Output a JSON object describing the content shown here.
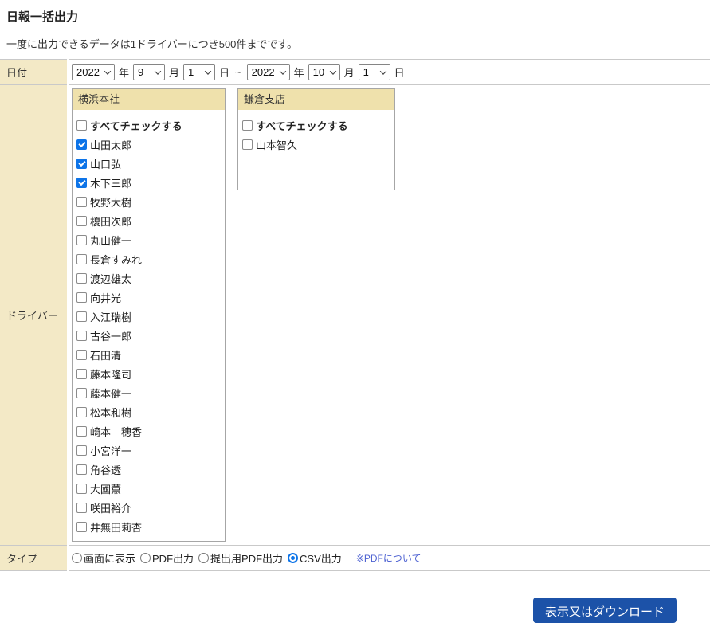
{
  "header": {
    "title": "日報一括出力",
    "note": "一度に出力できるデータは1ドライバーにつき500件までです。"
  },
  "date_row": {
    "label": "日付",
    "start": {
      "year": "2022",
      "month": "9",
      "day": "1"
    },
    "end": {
      "year": "2022",
      "month": "10",
      "day": "1"
    },
    "units": {
      "year": "年",
      "month": "月",
      "day": "日",
      "separator": "~"
    }
  },
  "driver_row": {
    "label": "ドライバー",
    "groups": [
      {
        "name": "横浜本社",
        "check_all_label": "すべてチェックする",
        "check_all_checked": false,
        "members": [
          {
            "name": "山田太郎",
            "checked": true
          },
          {
            "name": "山口弘",
            "checked": true
          },
          {
            "name": "木下三郎",
            "checked": true
          },
          {
            "name": "牧野大樹",
            "checked": false
          },
          {
            "name": "榎田次郎",
            "checked": false
          },
          {
            "name": "丸山健一",
            "checked": false
          },
          {
            "name": "長倉すみれ",
            "checked": false
          },
          {
            "name": "渡辺雄太",
            "checked": false
          },
          {
            "name": "向井光",
            "checked": false
          },
          {
            "name": "入江瑞樹",
            "checked": false
          },
          {
            "name": "古谷一郎",
            "checked": false
          },
          {
            "name": "石田清",
            "checked": false
          },
          {
            "name": "藤本隆司",
            "checked": false
          },
          {
            "name": "藤本健一",
            "checked": false
          },
          {
            "name": "松本和樹",
            "checked": false
          },
          {
            "name": "崎本　穂香",
            "checked": false
          },
          {
            "name": "小宮洋一",
            "checked": false
          },
          {
            "name": "角谷透",
            "checked": false
          },
          {
            "name": "大國薫",
            "checked": false
          },
          {
            "name": "咲田裕介",
            "checked": false
          },
          {
            "name": "井無田莉杏",
            "checked": false
          }
        ]
      },
      {
        "name": "鎌倉支店",
        "check_all_label": "すべてチェックする",
        "check_all_checked": false,
        "members": [
          {
            "name": "山本智久",
            "checked": false
          }
        ]
      }
    ]
  },
  "type_row": {
    "label": "タイプ",
    "options": [
      {
        "label": "画面に表示",
        "selected": false
      },
      {
        "label": "PDF出力",
        "selected": false
      },
      {
        "label": "提出用PDF出力",
        "selected": false
      },
      {
        "label": "CSV出力",
        "selected": true
      }
    ],
    "pdf_note": "※PDFについて"
  },
  "footer": {
    "submit_label": "表示又はダウンロード"
  },
  "colors": {
    "label_bg": "#f3e9c6",
    "group_header_bg": "#efe1ac",
    "checked_accent": "#0d74e8",
    "button_bg": "#1c52a8",
    "link": "#4f63d2",
    "row_border": "#c9c9c9"
  }
}
